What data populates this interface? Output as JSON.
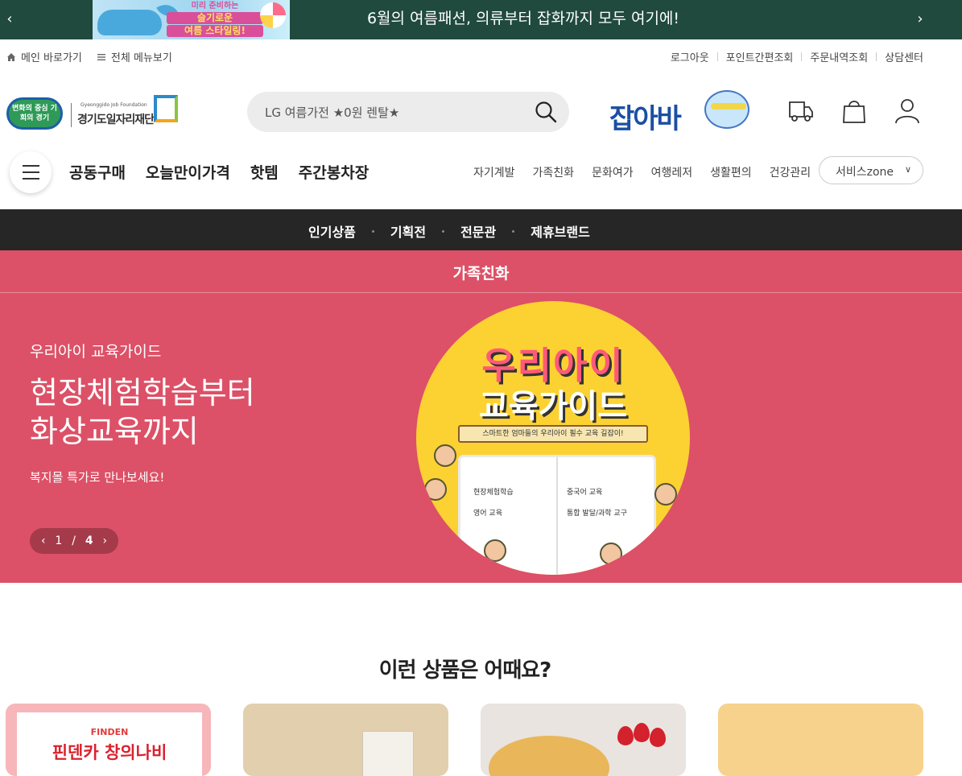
{
  "promo": {
    "title": "6월의 여름패션, 의류부터 잡화까지 모두 여기에!",
    "banner_line1": "미리 준비하는",
    "banner_line2": "슬기로운",
    "banner_line3": "여름 스타일링!",
    "prev_icon": "chevron-left-icon",
    "next_icon": "chevron-right-icon"
  },
  "util": {
    "home_link": "메인 바로가기",
    "all_menu": "전체 메뉴보기",
    "links": [
      "로그아웃",
      "포인트간편조회",
      "주문내역조회",
      "상담센터"
    ]
  },
  "header": {
    "logo_badge": "변화의 중심 기회의 경기",
    "logo_sub": "Gyeonggido Job Foundation",
    "logo_org": "경기도일자리재단",
    "search_placeholder": "LG 여름가전 ★0원 렌탈★",
    "jobaba": "잡아바",
    "icons": [
      "delivery-truck-icon",
      "shopping-bag-icon",
      "user-icon"
    ]
  },
  "nav": {
    "main": [
      "공동구매",
      "오늘만이가격",
      "핫템",
      "주간봉차장"
    ],
    "sub": [
      "자기계발",
      "가족친화",
      "문화여가",
      "여행레저",
      "생활편의",
      "건강관리"
    ],
    "service": "서비스zone"
  },
  "category_bar": [
    "인기상품",
    "기획전",
    "전문관",
    "제휴브랜드"
  ],
  "hero": {
    "section_title": "가족친화",
    "eyebrow": "우리아이 교육가이드",
    "headline_1": "현장체험학습부터",
    "headline_2": "화상교육까지",
    "description": "복지몰 특가로 만나보세요!",
    "pager_current": "1",
    "pager_sep": "/",
    "pager_total": "4",
    "image": {
      "title_1": "우리아이",
      "title_2": "교육가이드",
      "ribbon": "스마트한 엄마들의 우리아이 필수 교육 길잡이!",
      "items": [
        "현장체험학습",
        "영어 교육",
        "중국어 교육",
        "통합 발달/과학 교구"
      ]
    }
  },
  "recommend": {
    "title": "이런 상품은 어때요?",
    "card1_brand": "FINDEN",
    "card1_name": "핀덴카 창의나비"
  },
  "colors": {
    "promo_bg": "#1f4a3d",
    "hero_bg": "#dc5167",
    "category_bar_bg": "#262626",
    "brand_blue": "#1a4fa3"
  }
}
